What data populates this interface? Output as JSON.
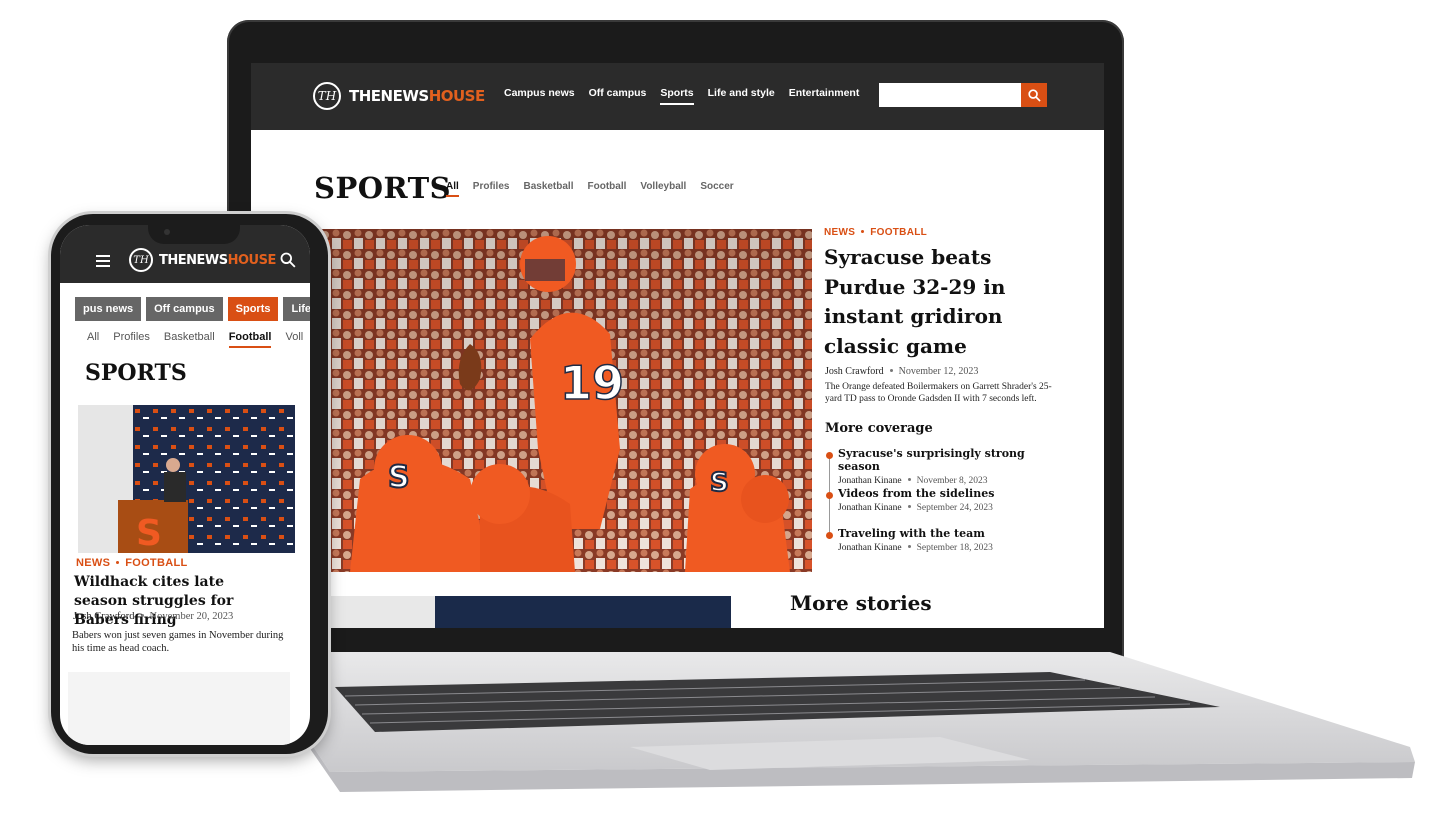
{
  "brand": {
    "logo_mark": "TH",
    "logo_word1": "THENEWS",
    "logo_word2": "HOUSE",
    "accent": "#d94f14"
  },
  "desktop": {
    "nav": [
      "Campus news",
      "Off campus",
      "Sports",
      "Life and style",
      "Entertainment"
    ],
    "nav_active": "Sports",
    "section_title": "SPORTS",
    "tabs": [
      "All",
      "Profiles",
      "Basketball",
      "Football",
      "Volleyball",
      "Soccer"
    ],
    "tab_active": "All",
    "lead": {
      "kicker_1": "NEWS",
      "kicker_2": "FOOTBALL",
      "headline": "Syracuse beats Purdue 32-29 in instant gridiron classic game",
      "author": "Josh Crawford",
      "date": "November 12, 2023",
      "summary": "The Orange defeated Boilermakers on Garrett Shrader's 25-yard TD pass to Oronde Gadsden II with 7 seconds left."
    },
    "more_coverage_title": "More coverage",
    "more_coverage": [
      {
        "title": "Syracuse's surprisingly strong season",
        "author": "Jonathan Kinane",
        "date": "November 8, 2023"
      },
      {
        "title": "Videos from the sidelines",
        "author": "Jonathan Kinane",
        "date": "September 24, 2023"
      },
      {
        "title": "Traveling with the team",
        "author": "Jonathan Kinane",
        "date": "September 18, 2023"
      }
    ],
    "more_stories_title": "More stories"
  },
  "mobile": {
    "categories": [
      "pus news",
      "Off campus",
      "Sports",
      "Life and s"
    ],
    "category_active": "Sports",
    "tabs": [
      "All",
      "Profiles",
      "Basketball",
      "Football",
      "Voll"
    ],
    "tab_active": "Football",
    "section_title": "SPORTS",
    "lead": {
      "kicker_1": "NEWS",
      "kicker_2": "FOOTBALL",
      "headline": "Wildhack cites late season struggles for Babers firing",
      "author": "Josh Crawford",
      "date": "November 20, 2023",
      "summary": "Babers won just seven games in November during his time as head coach."
    }
  },
  "icons": {
    "search": "search-icon",
    "menu": "hamburger-menu-icon"
  }
}
